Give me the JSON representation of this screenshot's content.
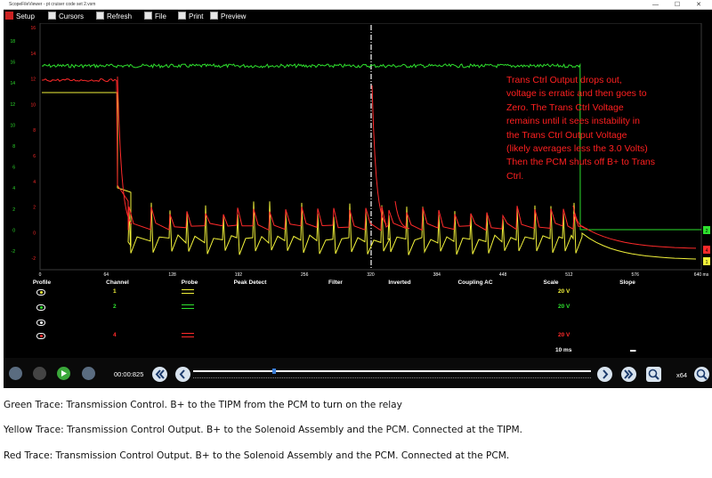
{
  "window": {
    "title": "ScopeFileViewer - pt cruiser code set 2.vsm",
    "controls": "—  ☐  ✕"
  },
  "toolbar": {
    "setup": "Setup",
    "cursors": "Cursors",
    "refresh": "Refresh",
    "file": "File",
    "print": "Print",
    "preview": "Preview"
  },
  "scope": {
    "y_ticks_red": [
      "16",
      "14",
      "12",
      "10",
      "8",
      "6",
      "4",
      "2",
      "0",
      "-2"
    ],
    "y_ticks_green": [
      "18",
      "16",
      "14",
      "12",
      "10",
      "8",
      "6",
      "4",
      "2",
      "0",
      "-2"
    ],
    "x_ticks": [
      "0",
      "64",
      "128",
      "192",
      "256",
      "320",
      "384",
      "448",
      "512",
      "576",
      "640 ms"
    ],
    "trace_colors": {
      "green": "#2ee02e",
      "yellow": "#f2f23a",
      "red": "#ff2a2a"
    },
    "markers": [
      "2",
      "4",
      "1"
    ],
    "annotation": "Trans Ctrl Output drops out,\nvoltage is erratic and then goes to\nZero. The Trans Ctrl Voltage\nremains until it sees instability in\nthe Trans Ctrl Output Voltage\n(likely averages less the 3.0 Volts)\nThen the PCM shuts off B+ to Trans\nCtrl."
  },
  "channel_table": {
    "headers": [
      "Profile",
      "Channel",
      "Probe",
      "Peak Detect",
      "Filter",
      "Inverted",
      "Coupling AC",
      "Scale",
      "Slope"
    ],
    "rows": [
      {
        "channel": "1",
        "color": "#f2f23a",
        "scale": "20 V"
      },
      {
        "channel": "2",
        "color": "#2ee02e",
        "scale": "20 V"
      },
      {
        "channel": "",
        "color": "#ffffff",
        "scale": ""
      },
      {
        "channel": "4",
        "color": "#ff2a2a",
        "scale": "20 V"
      }
    ],
    "timebase": "10 ms",
    "slope": "▬"
  },
  "playback": {
    "time": "00:00:825",
    "zoom": "x64",
    "position_fraction": 0.2
  },
  "captions": [
    "Green Trace: Transmission Control. B+ to the TIPM from the PCM to turn on the relay",
    "Yellow Trace: Transmission Control Output. B+ to the Solenoid Assembly and the PCM. Connected at the TIPM.",
    "Red Trace: Transmission Control Output. B+ to the Solenoid Assembly and the PCM. Connected at the PCM."
  ]
}
